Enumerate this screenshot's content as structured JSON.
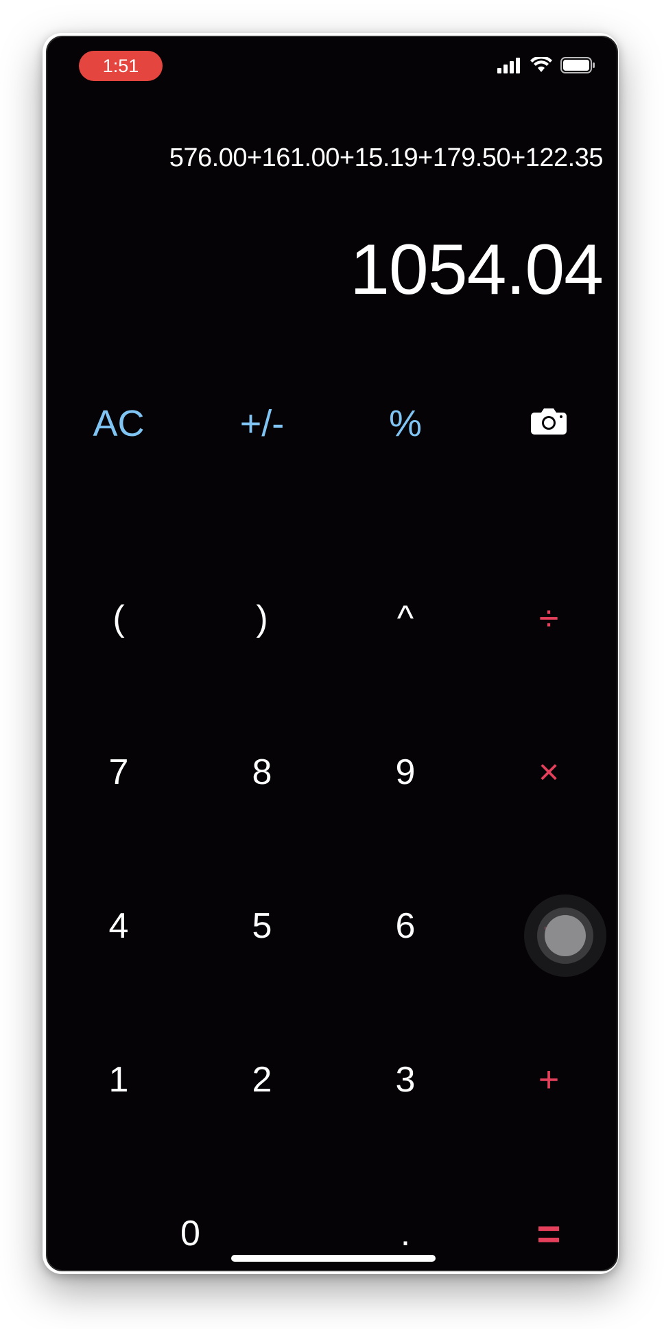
{
  "status_bar": {
    "time": "1:51",
    "icons": [
      "cellular-signal-icon",
      "wifi-icon",
      "battery-icon"
    ]
  },
  "display": {
    "expression": "576.00+161.00+15.19+179.50+122.35",
    "result": "1054.04"
  },
  "keypad": {
    "row1": {
      "clear": "AC",
      "sign": "+/-",
      "percent": "%",
      "camera_icon": "camera-icon"
    },
    "row2": {
      "open_paren": "(",
      "close_paren": ")",
      "power": "^",
      "divide": "÷"
    },
    "row3": {
      "seven": "7",
      "eight": "8",
      "nine": "9",
      "multiply": "×"
    },
    "row4": {
      "four": "4",
      "five": "5",
      "six": "6",
      "subtract": "-"
    },
    "row5": {
      "one": "1",
      "two": "2",
      "three": "3",
      "add": "+"
    },
    "row6": {
      "zero": "0",
      "decimal": ".",
      "equals": "="
    }
  },
  "colors": {
    "background": "#050306",
    "function_keys": "#7fc4f2",
    "operator_keys": "#e4405c",
    "digits": "#ffffff",
    "time_pill": "#e4463f"
  }
}
